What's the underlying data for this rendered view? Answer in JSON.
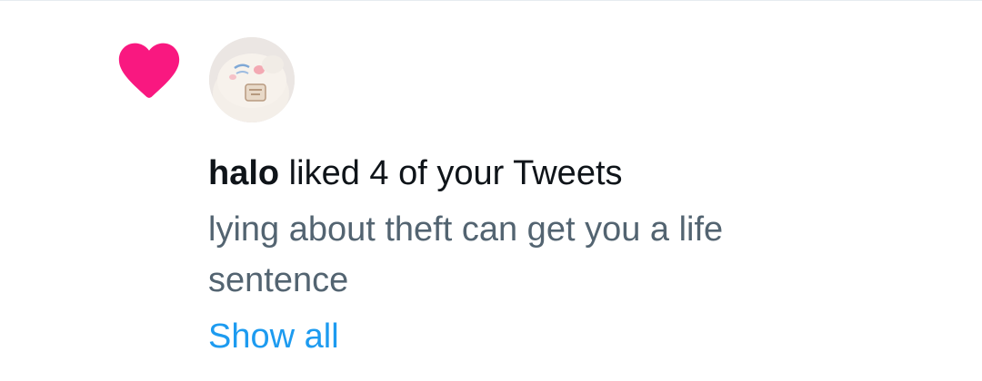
{
  "notification": {
    "icon": "heart-icon",
    "accent_color": "#f91880",
    "avatar": "user-avatar",
    "username": "halo",
    "action_text": " liked 4 of your Tweets",
    "tweet_text": "lying about theft can get you a life sentence",
    "show_all_label": "Show all",
    "link_color": "#1d9bf0",
    "secondary_text_color": "#536471"
  }
}
